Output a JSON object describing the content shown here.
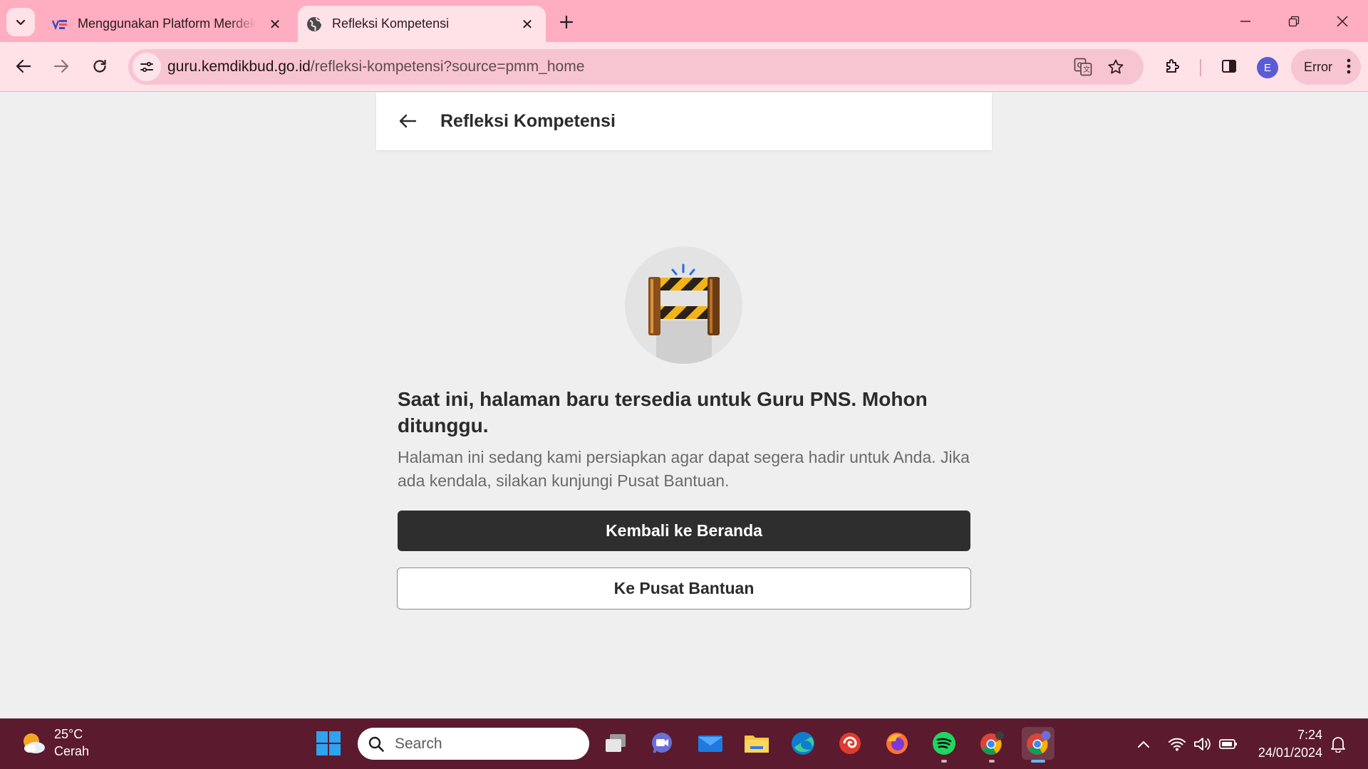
{
  "browser": {
    "tabs": [
      {
        "title": "Menggunakan Platform Merdeka Mengajar",
        "active": false,
        "favicon": "pmm-logo-icon"
      },
      {
        "title": "Refleksi Kompetensi",
        "active": true,
        "favicon": "globe-icon"
      }
    ],
    "url_host": "guru.kemdikbud.go.id",
    "url_path": "/refleksi-kompetensi?source=pmm_home",
    "profile_initial": "E",
    "error_label": "Error"
  },
  "page": {
    "header_title": "Refleksi Kompetensi",
    "heading": "Saat ini, halaman baru tersedia untuk Guru PNS. Mohon ditunggu.",
    "description": "Halaman ini sedang kami persiapkan agar dapat segera hadir untuk Anda. Jika ada kendala, silakan kunjungi Pusat Bantuan.",
    "primary_button": "Kembali ke Beranda",
    "secondary_button": "Ke Pusat Bantuan"
  },
  "taskbar": {
    "weather_temp": "25°C",
    "weather_desc": "Cerah",
    "search_placeholder": "Search",
    "time": "7:24",
    "date": "24/01/2024"
  },
  "colors": {
    "tabstrip": "#ffadc0",
    "toolbar": "#ffe1e8",
    "omnibox": "#f7c5d1",
    "page_background": "#efefef",
    "primary_button": "#2e2e2e",
    "taskbar": "#5b1a2d"
  }
}
